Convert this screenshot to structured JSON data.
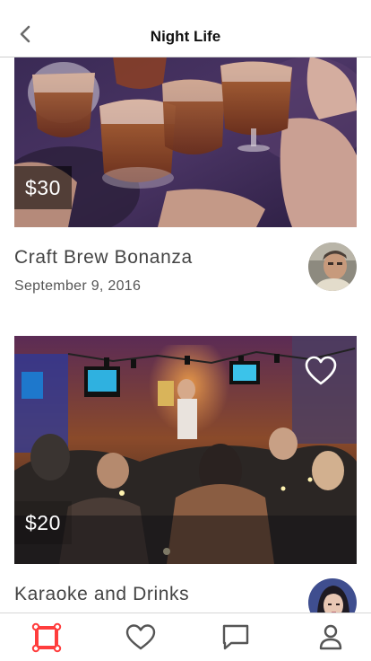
{
  "header": {
    "title": "Night Life",
    "back_icon": "chevron-left-icon"
  },
  "events": [
    {
      "price": "$30",
      "title": "Craft Brew Bonanza",
      "date": "September 9, 2016",
      "favorited": false
    },
    {
      "price": "$20",
      "title": "Karaoke and Drinks",
      "date": "",
      "favorited": false
    }
  ],
  "tabbar": {
    "active": "explore",
    "active_color": "#ff3d3d",
    "inactive_color": "#555555",
    "tabs": [
      {
        "id": "explore",
        "icon": "explore-grid-icon"
      },
      {
        "id": "favorites",
        "icon": "heart-icon"
      },
      {
        "id": "messages",
        "icon": "chat-bubble-icon"
      },
      {
        "id": "profile",
        "icon": "person-icon"
      }
    ]
  }
}
